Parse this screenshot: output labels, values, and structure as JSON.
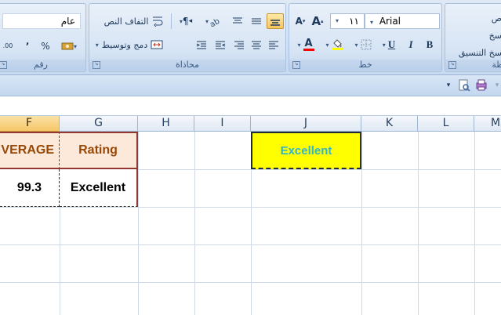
{
  "ribbon": {
    "number_group": {
      "label": "رقم",
      "format_value": "عام",
      "percent": "%",
      "comma": "٬",
      "dec_increase": ".0",
      "dec_decrease": ".00"
    },
    "alignment_group": {
      "label": "محاذاة",
      "wrap_text": "التفاف النص",
      "merge_center": "دمج وتوسيط"
    },
    "font_group": {
      "label": "خط",
      "font_name": "Arial",
      "font_size": "١١",
      "bold": "B",
      "italic": "I",
      "underline": "U",
      "grow_font": "A",
      "shrink_font": "A",
      "font_color_letter": "A"
    },
    "clipboard_group": {
      "label": "ظة",
      "cut": "ص",
      "copy": "سخ",
      "format_painter": "سخ التنسيق"
    }
  },
  "columns": [
    "F",
    "G",
    "H",
    "I",
    "J",
    "K",
    "L",
    "M"
  ],
  "selected_column": "F",
  "cells": {
    "f_header": "VERAGE",
    "g_header": "Rating",
    "f_value": "99.3",
    "g_value": "Excellent",
    "j_value": "Excellent"
  },
  "colors": {
    "header_fill": "#fde9d9",
    "header_text": "#984806",
    "table_border": "#943634",
    "j_fill": "#ffff00",
    "j_text": "#31b5c8"
  },
  "icons": [
    "paint-bucket-icon",
    "borders-icon",
    "wrap-text-icon",
    "merge-icon",
    "print-preview-icon",
    "quick-access-dropdown-icon"
  ]
}
